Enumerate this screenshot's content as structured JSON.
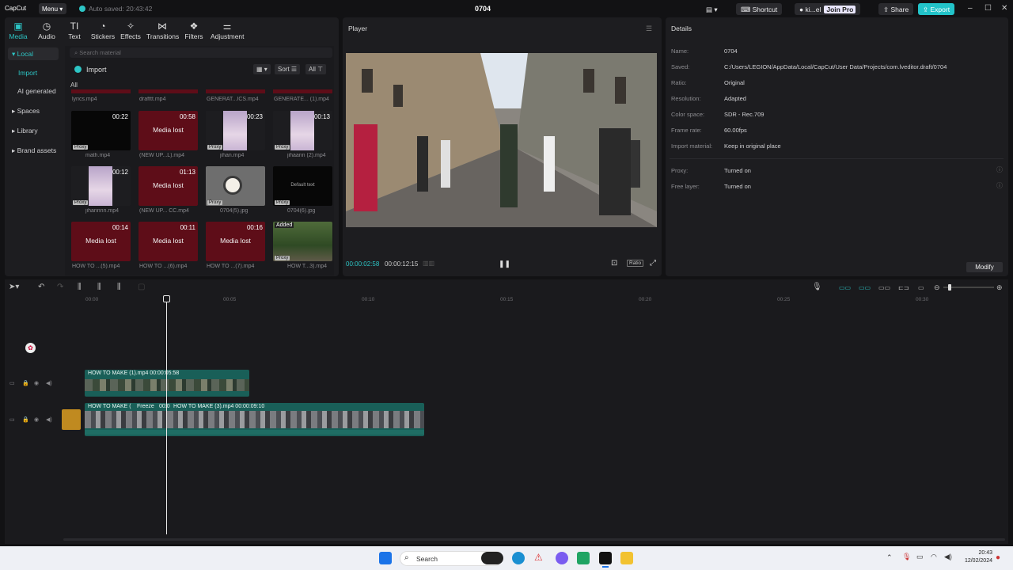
{
  "titlebar": {
    "app_name": "CapCut",
    "menu_label": "Menu",
    "autosave": "Auto saved: 20:43:42",
    "project_title": "0704",
    "shortcut_label": "Shortcut",
    "user_label": "ki...el",
    "join_pro": "Join Pro",
    "share_label": "Share",
    "export_label": "Export"
  },
  "toolbar": {
    "tabs": [
      {
        "label": "Media",
        "icon": "media-icon"
      },
      {
        "label": "Audio",
        "icon": "audio-icon"
      },
      {
        "label": "Text",
        "icon": "text-icon"
      },
      {
        "label": "Stickers",
        "icon": "stickers-icon"
      },
      {
        "label": "Effects",
        "icon": "effects-icon"
      },
      {
        "label": "Transitions",
        "icon": "transitions-icon"
      },
      {
        "label": "Filters",
        "icon": "filters-icon"
      },
      {
        "label": "Adjustment",
        "icon": "adjustment-icon"
      }
    ]
  },
  "sidenav": {
    "items": [
      "Local",
      "Import",
      "AI generated",
      "Spaces",
      "Library",
      "Brand assets"
    ]
  },
  "media": {
    "search_placeholder": "Search material",
    "import_label": "Import",
    "sort_label": "Sort",
    "all_filter": "All",
    "all_label": "All",
    "top_row_captions": [
      "lyrics.mp4",
      "drafttt.mp4",
      "GENERAT...ICS.mp4",
      "GENERATE... (1).mp4"
    ],
    "lost_text": "Media lost",
    "proxy_text": "Proxy",
    "added_text": "Added",
    "cards": [
      {
        "duration": "00:22",
        "caption": "math.mp4",
        "type": "black"
      },
      {
        "duration": "00:58",
        "caption": "(NEW UP...L).mp4",
        "type": "lost"
      },
      {
        "duration": "00:23",
        "caption": "jihan.mp4",
        "type": "photo"
      },
      {
        "duration": "00:13",
        "caption": "jihaann (2).mp4",
        "type": "photo"
      },
      {
        "duration": "00:12",
        "caption": "jihannnn.mp4",
        "type": "photo"
      },
      {
        "duration": "01:13",
        "caption": "(NEW UP... CC.mp4",
        "type": "lost"
      },
      {
        "duration": "",
        "caption": "0704(5).jpg",
        "type": "grey"
      },
      {
        "duration": "",
        "caption": "0704(6).jpg",
        "type": "black"
      },
      {
        "duration": "00:14",
        "caption": "HOW TO ...(5).mp4",
        "type": "lost"
      },
      {
        "duration": "00:11",
        "caption": "HOW TO ...(6).mp4",
        "type": "lost"
      },
      {
        "duration": "00:16",
        "caption": "HOW TO ...(7).mp4",
        "type": "lost"
      },
      {
        "duration": "",
        "caption": "HOW T...3).mp4",
        "type": "forest"
      }
    ],
    "default_text_thumb": "Default text"
  },
  "player": {
    "title": "Player",
    "current_time": "00:00:02:58",
    "total_time": "00:00:12:15",
    "ratio_label": "Ratio"
  },
  "details": {
    "title": "Details",
    "rows": [
      {
        "label": "Name:",
        "value": "0704"
      },
      {
        "label": "Saved:",
        "value": "C:/Users/LEGION/AppData/Local/CapCut/User Data/Projects/com.lveditor.draft/0704"
      },
      {
        "label": "Ratio:",
        "value": "Original"
      },
      {
        "label": "Resolution:",
        "value": "Adapted"
      },
      {
        "label": "Color space:",
        "value": "SDR - Rec.709"
      },
      {
        "label": "Frame rate:",
        "value": "60.00fps"
      },
      {
        "label": "Import material:",
        "value": "Keep in original place"
      }
    ],
    "proxy_label": "Proxy:",
    "proxy_value": "Turned on",
    "freelayer_label": "Free layer:",
    "freelayer_value": "Turned on",
    "modify_label": "Modify"
  },
  "timeline": {
    "ruler": [
      "00:00",
      "00:05",
      "00:10",
      "00:15",
      "00:20",
      "00:25",
      "00:30"
    ],
    "overlay_clip": "HOW TO MAKE (1).mp4   00:00:05:58",
    "main_clip_a": "HOW TO MAKE (",
    "main_clip_freeze": "Freeze",
    "main_clip_b": "00:0",
    "main_clip_c": "HOW TO MAKE (3).mp4   00:00:09:10"
  },
  "taskbar": {
    "search": "Search",
    "time": "20:43",
    "date": "12/02/2024"
  }
}
